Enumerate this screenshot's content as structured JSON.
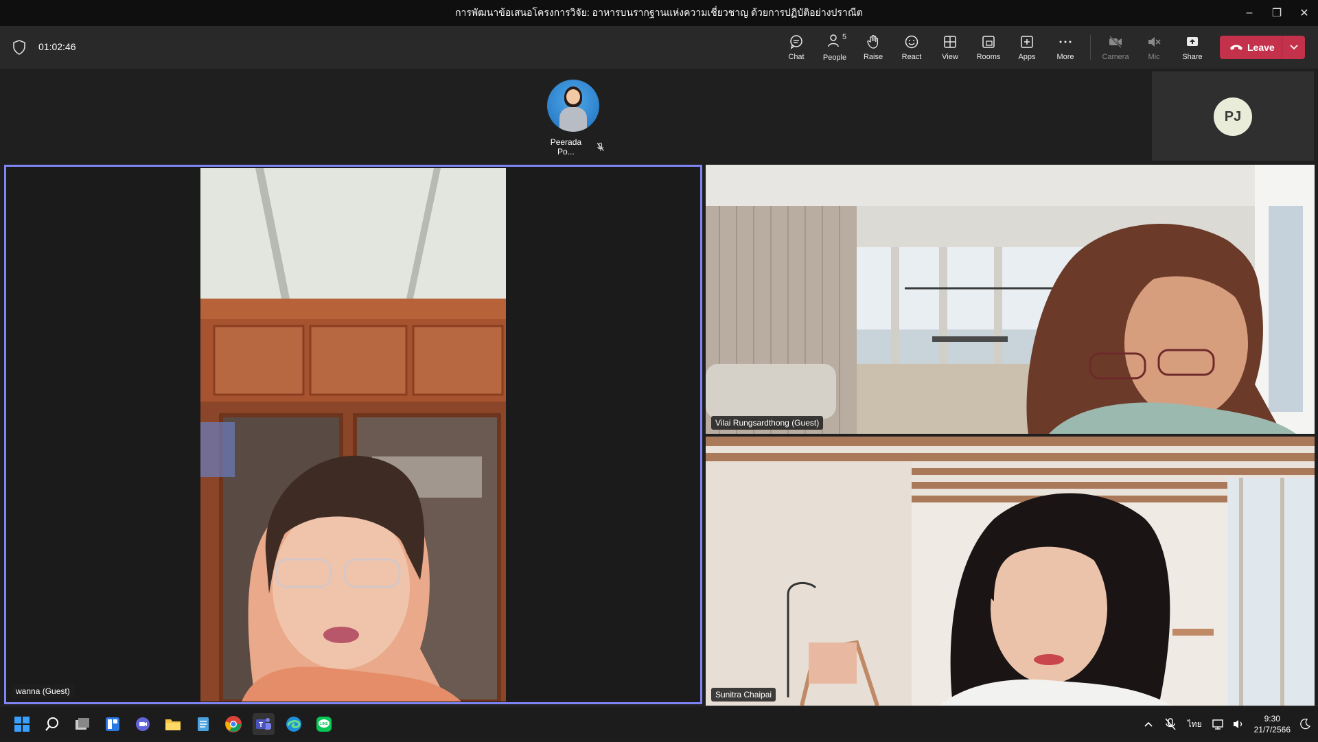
{
  "window": {
    "title": "การพัฒนาข้อเสนอโครงการวิจัย: อาหารบนรากฐานแห่งความเชี่ยวชาญ ด้วยการปฏิบัติอย่างปราณีต",
    "minimize": "–",
    "restore": "❐",
    "close": "✕"
  },
  "meeting": {
    "timer": "01:02:46"
  },
  "toolbar": {
    "chat": "Chat",
    "people": "People",
    "people_count": "5",
    "raise": "Raise",
    "react": "React",
    "view": "View",
    "rooms": "Rooms",
    "apps": "Apps",
    "more": "More",
    "camera": "Camera",
    "mic": "Mic",
    "share": "Share",
    "leave": "Leave"
  },
  "pinned": {
    "name": "Peerada Po..."
  },
  "self_tile": {
    "initials": "PJ"
  },
  "tiles": [
    {
      "name": "wanna (Guest)"
    },
    {
      "name": "Vilai Rungsardthong (Guest)"
    },
    {
      "name": "Sunitra Chaipai"
    }
  ],
  "taskbar": {
    "time": "9:30",
    "date": "21/7/2566",
    "language": "ไทย"
  },
  "colors": {
    "accent": "#7f85f5",
    "leave": "#c4314b"
  }
}
